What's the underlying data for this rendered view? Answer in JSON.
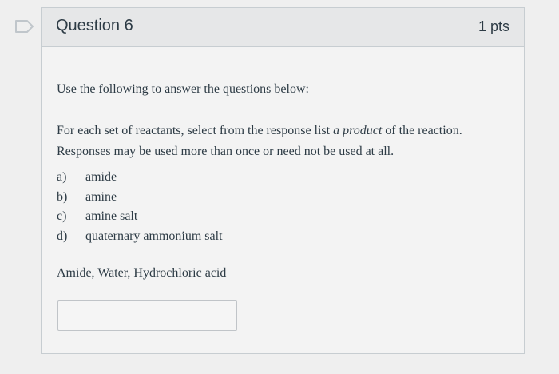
{
  "question": {
    "title": "Question 6",
    "points": "1 pts"
  },
  "body": {
    "intro": "Use the following to answer the questions below:",
    "instruction_part1": "For each set of reactants, select from the response list ",
    "instruction_emph": "a product",
    "instruction_part2": " of the reaction.",
    "instruction_line2": "Responses may be used more than once or need not be used at all.",
    "options": [
      {
        "letter": "a)",
        "text": "amide"
      },
      {
        "letter": "b)",
        "text": "amine"
      },
      {
        "letter": "c)",
        "text": "amine salt"
      },
      {
        "letter": "d)",
        "text": "quaternary ammonium salt"
      }
    ],
    "prompt": "Amide, Water, Hydrochloric acid",
    "answer_value": ""
  },
  "icons": {
    "flag": "bookmark-flag-icon"
  },
  "colors": {
    "text": "#2d3b45",
    "header_bg": "#e6e7e8",
    "border": "#c7cdd1"
  }
}
